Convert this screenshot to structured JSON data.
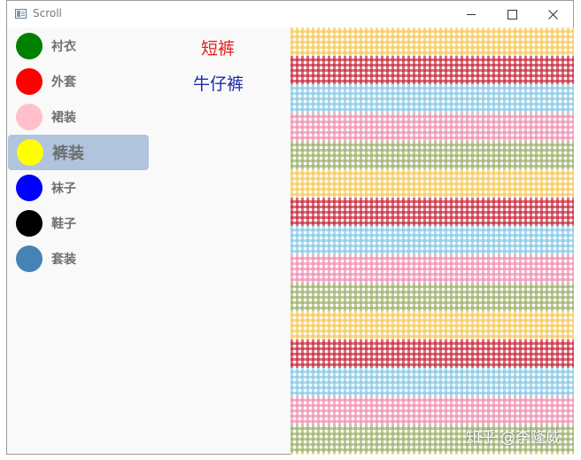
{
  "window": {
    "title": "Scroll",
    "buttons": [
      "minimize",
      "maximize",
      "close"
    ]
  },
  "nav": {
    "items": [
      {
        "label": "衬衣",
        "color": "#008000",
        "selected": false
      },
      {
        "label": "外套",
        "color": "#ff0000",
        "selected": false
      },
      {
        "label": "裙装",
        "color": "#ffc0cb",
        "selected": false
      },
      {
        "label": "裤装",
        "color": "#ffff00",
        "selected": true
      },
      {
        "label": "袜子",
        "color": "#0000ff",
        "selected": false
      },
      {
        "label": "鞋子",
        "color": "#000000",
        "selected": false
      },
      {
        "label": "套装",
        "color": "#4682b4",
        "selected": false
      }
    ],
    "selected_bg": "#b0c4de"
  },
  "subitems": [
    {
      "label": "短裤",
      "color": "#e0201a"
    },
    {
      "label": "牛仔裤",
      "color": "#1a2aa8"
    }
  ],
  "pattern": {
    "colors": [
      "#f6c85a",
      "#c8263a",
      "#86c8e6",
      "#ee8fb0",
      "#9cb06a"
    ]
  },
  "watermark": "知乎 @李隆威"
}
